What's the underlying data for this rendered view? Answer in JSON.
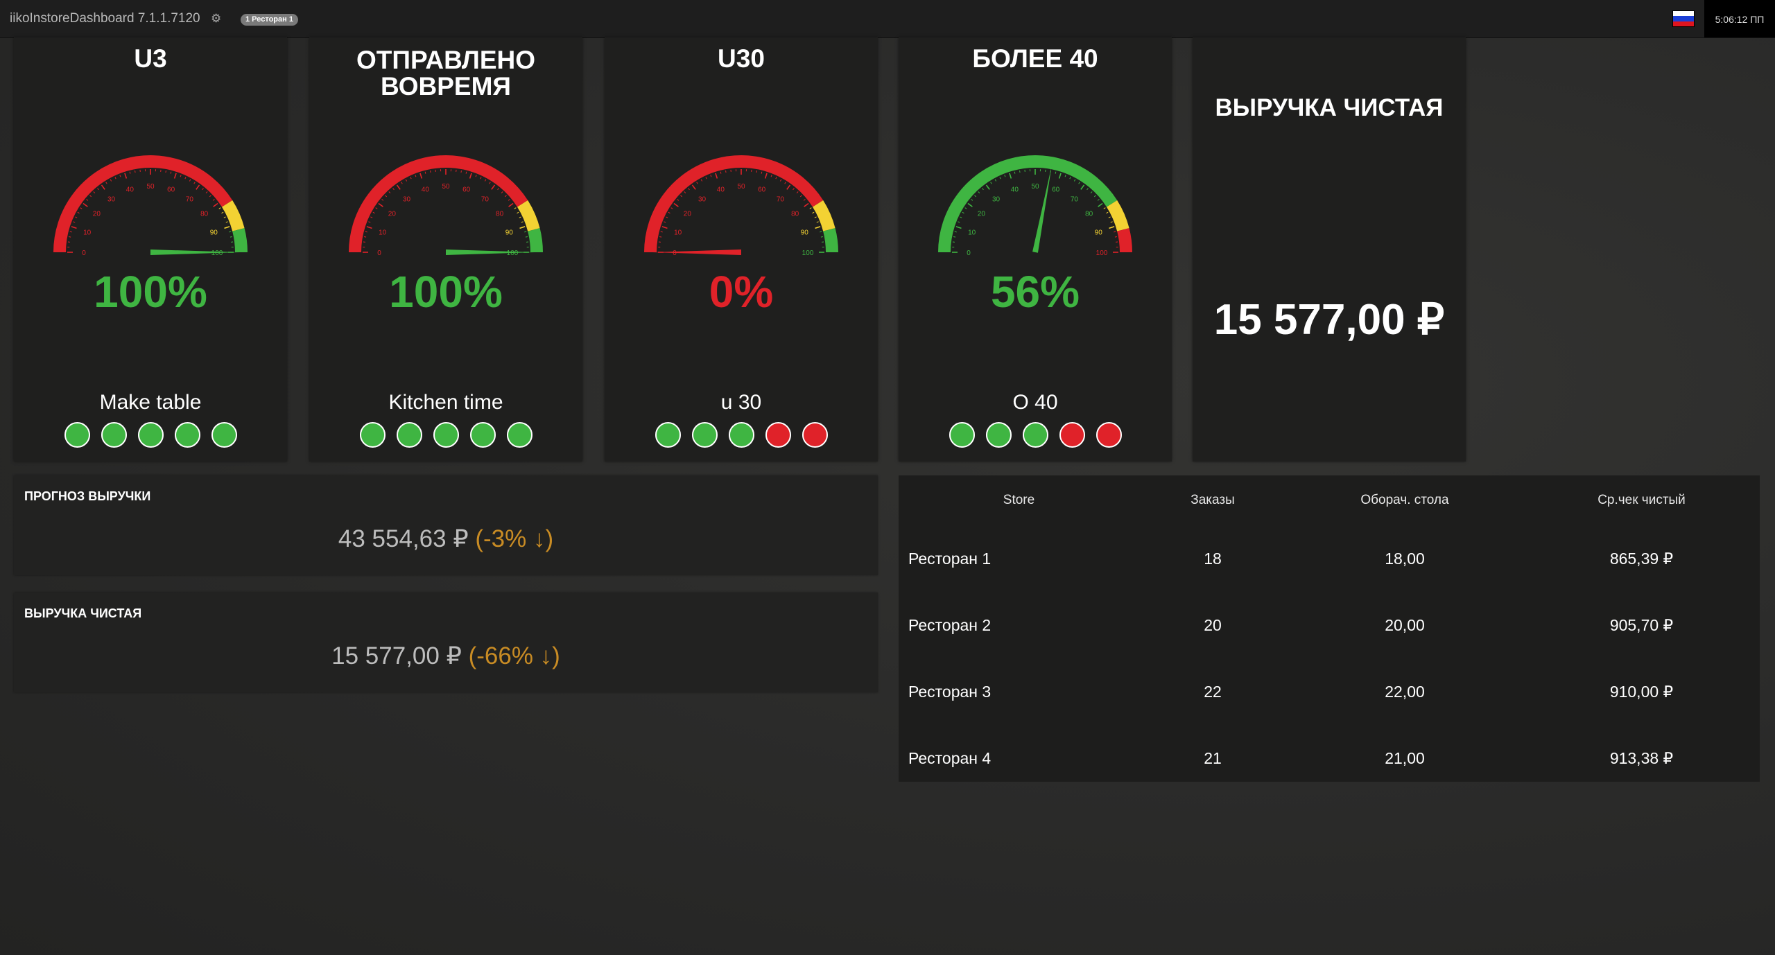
{
  "header": {
    "app_title": "iikoInstoreDashboard 7.1.1.7120",
    "settings_icon": "gear-icon",
    "store_filter": "1 Ресторан 1",
    "flag_icon": "russia-flag-icon",
    "clock": "5:06:12 ПП",
    "flag_colors": [
      "#ffffff",
      "#1c3fd6",
      "#e0151f"
    ]
  },
  "colors": {
    "green": "#3fb542",
    "red": "#e02229",
    "yellow": "#f3d233",
    "orange": "#c98c24"
  },
  "gauge_scale": [
    "0",
    "10",
    "20",
    "30",
    "40",
    "50",
    "60",
    "70",
    "80",
    "90",
    "100"
  ],
  "gauges": [
    {
      "title": "U3",
      "percent": "100%",
      "value": 100,
      "subtitle": "Make table",
      "scheme": "normal",
      "dots": [
        "green",
        "green",
        "green",
        "green",
        "green"
      ]
    },
    {
      "title": "ОТПРАВЛЕНО ВОВРЕМЯ",
      "percent": "100%",
      "value": 100,
      "subtitle": "Kitchen time",
      "scheme": "normal",
      "dots": [
        "green",
        "green",
        "green",
        "green",
        "green"
      ]
    },
    {
      "title": "U30",
      "percent": "0%",
      "value": 0,
      "subtitle": "u 30",
      "scheme": "normal",
      "dots": [
        "green",
        "green",
        "green",
        "red",
        "red"
      ]
    },
    {
      "title": "БОЛЕЕ 40",
      "percent": "56%",
      "value": 56,
      "subtitle": "O 40",
      "scheme": "inverted",
      "dots": [
        "green",
        "green",
        "green",
        "red",
        "red"
      ]
    }
  ],
  "revenue_card": {
    "title": "ВЫРУЧКА ЧИСТАЯ",
    "value": "15 577,00 ₽"
  },
  "kpis": [
    {
      "label": "ПРОГНОЗ ВЫРУЧКИ",
      "value": "43 554,63 ₽",
      "change": "(-3% ↓)"
    },
    {
      "label": "ВЫРУЧКА ЧИСТАЯ",
      "value": "15 577,00 ₽",
      "change": "(-66% ↓)"
    }
  ],
  "stores_table": {
    "headers": [
      "Store",
      "Заказы",
      "Оборач. стола",
      "Ср.чек чистый"
    ],
    "rows": [
      [
        "Ресторан 1",
        "18",
        "18,00",
        "865,39 ₽"
      ],
      [
        "Ресторан 2",
        "20",
        "20,00",
        "905,70 ₽"
      ],
      [
        "Ресторан 3",
        "22",
        "22,00",
        "910,00 ₽"
      ],
      [
        "Ресторан 4",
        "21",
        "21,00",
        "913,38 ₽"
      ]
    ]
  }
}
